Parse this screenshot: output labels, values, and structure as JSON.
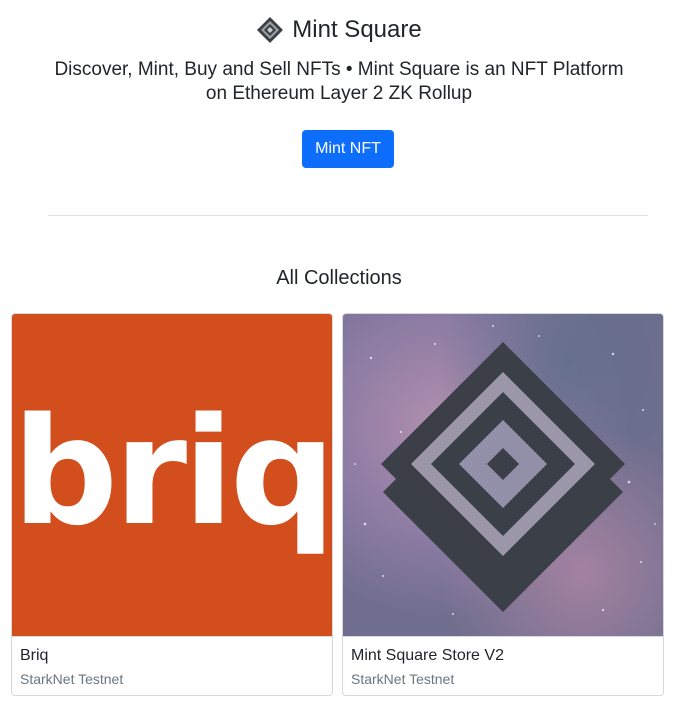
{
  "header": {
    "brand_name": "Mint Square",
    "brand_logo_icon": "mint-square-diamond-icon",
    "tagline_line1": "Discover, Mint, Buy and Sell NFTs • Mint Square is an NFT Platform",
    "tagline_line2": "on Ethereum Layer 2 ZK Rollup",
    "mint_button_label": "Mint NFT"
  },
  "collections": {
    "section_title": "All Collections",
    "items": [
      {
        "name": "Briq",
        "network": "StarkNet Testnet",
        "image_text": "briq",
        "image_bg": "#d24e1c"
      },
      {
        "name": "Mint Square Store V2",
        "network": "StarkNet Testnet",
        "image_icon": "mint-square-diamond-icon",
        "image_bg": "#7a6f92"
      }
    ]
  },
  "colors": {
    "accent": "#0d6efd",
    "text": "#212529",
    "muted": "#6c757d",
    "divider": "#dee2e6"
  }
}
